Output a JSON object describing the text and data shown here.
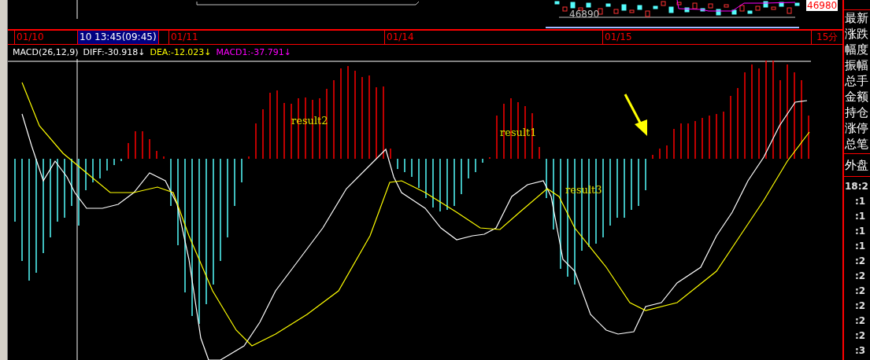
{
  "price_panel": {
    "price_tag": "46980",
    "low_label": "46890"
  },
  "time_axis": {
    "labels": [
      {
        "text": "01/10",
        "selected": false
      },
      {
        "text": "10 13:45(09:45)",
        "selected": true
      },
      {
        "text": "01/11",
        "selected": false
      },
      {
        "text": "01/14",
        "selected": false
      },
      {
        "text": "01/15",
        "selected": false
      }
    ],
    "period": "15分"
  },
  "indicator": {
    "name": "MACD(26,12,9)",
    "values": [
      {
        "text": "DIFF:-30.918↓",
        "color": "#ffffff"
      },
      {
        "text": "DEA:-12.023↓",
        "color": "#ffff00"
      },
      {
        "text": "MACD1:-37.791↓",
        "color": "#ff00ff"
      }
    ]
  },
  "chart": {
    "annotations": [
      "result2",
      "result1",
      "result3"
    ]
  },
  "side_panel": {
    "labels": [
      "最新",
      "涨跌",
      "幅度",
      "振幅",
      "总手",
      "金额",
      "持仓",
      "涨停",
      "总笔"
    ],
    "outer": "外盘",
    "times": [
      "18:2",
      ":1",
      ":1",
      ":1",
      ":1",
      ":2",
      ":2",
      ":2",
      ":2",
      ":2",
      ":2",
      ":3"
    ]
  }
}
